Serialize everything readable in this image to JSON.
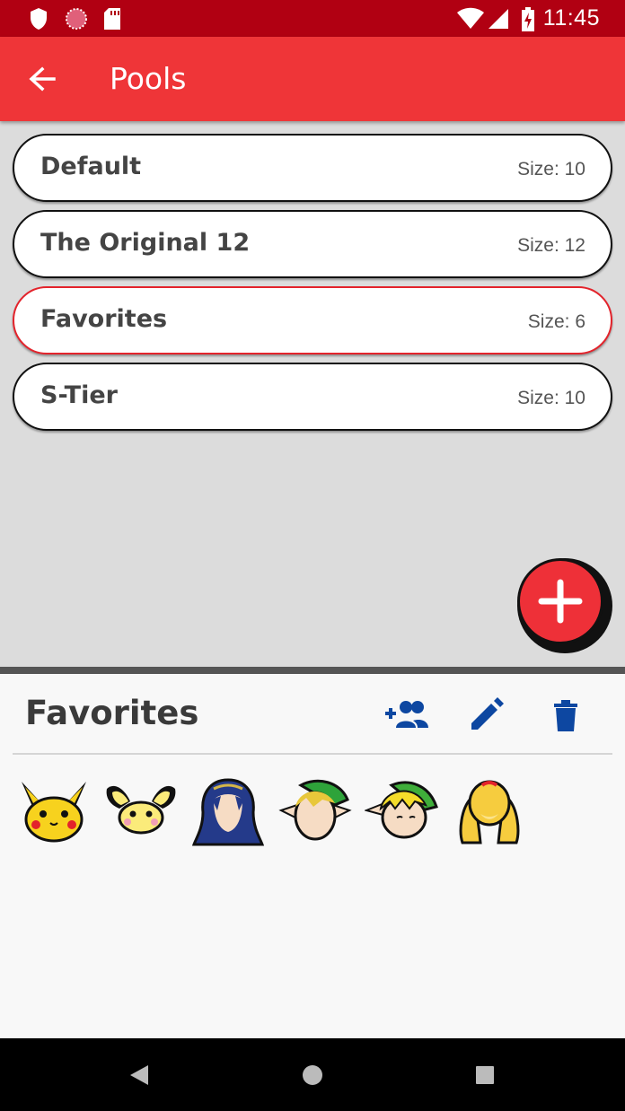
{
  "status_bar": {
    "time": "11:45",
    "icons": [
      "shield-icon",
      "globe-icon",
      "sd-card-icon",
      "wifi-icon",
      "signal-icon",
      "battery-charging-icon"
    ]
  },
  "app_bar": {
    "title": "Pools",
    "back_icon": "arrow-left-icon"
  },
  "pools": [
    {
      "name": "Default",
      "size": "Size: 10",
      "selected": false
    },
    {
      "name": "The Original 12",
      "size": "Size: 12",
      "selected": false
    },
    {
      "name": "Favorites",
      "size": "Size: 6",
      "selected": true
    },
    {
      "name": "S-Tier",
      "size": "Size: 10",
      "selected": false
    }
  ],
  "fab": {
    "icon": "plus-icon"
  },
  "panel": {
    "title": "Favorites",
    "actions": [
      "add-group-icon",
      "edit-pencil-icon",
      "delete-trash-icon"
    ],
    "fighters": [
      "pikachu-icon",
      "pichu-icon",
      "lucina-icon",
      "young-link-icon",
      "toon-link-icon",
      "isabelle-icon"
    ]
  },
  "nav_bar": {
    "buttons": [
      "back-triangle-icon",
      "home-circle-icon",
      "recents-square-icon"
    ]
  },
  "colors": {
    "status_bar": "#b10012",
    "app_bar": "#ef3538",
    "accent_red": "#e3232b",
    "action_blue": "#0d47a1"
  }
}
